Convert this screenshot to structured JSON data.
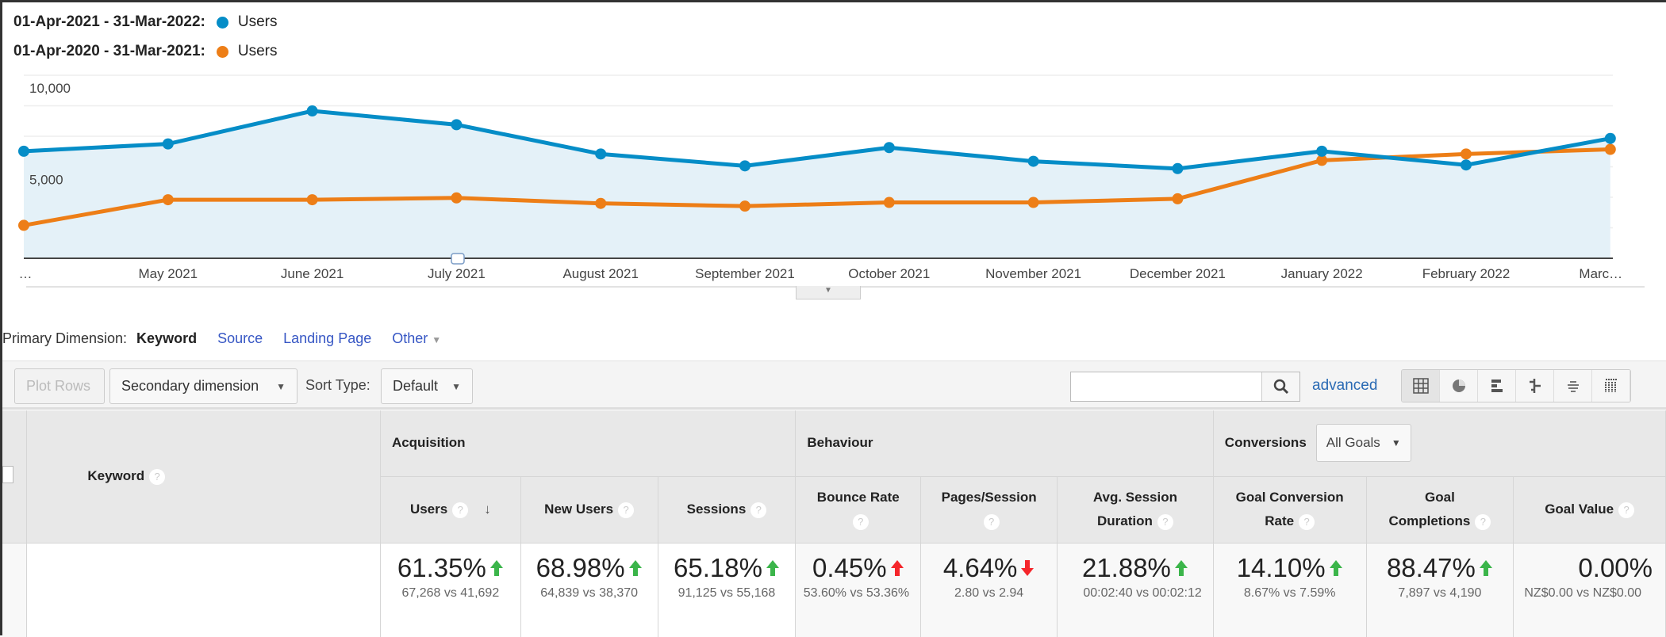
{
  "legend": [
    {
      "label": "01-Apr-2021 - 31-Mar-2022:",
      "series": "Users",
      "color": "#058dc7"
    },
    {
      "label": "01-Apr-2020 - 31-Mar-2021:",
      "series": "Users",
      "color": "#ed7e17"
    }
  ],
  "chart_data": {
    "type": "line",
    "x": [
      "…",
      "May 2021",
      "June 2021",
      "July 2021",
      "August 2021",
      "September 2021",
      "October 2021",
      "November 2021",
      "December 2021",
      "January 2022",
      "February 2022",
      "Marc…"
    ],
    "yticks": [
      "10,000",
      "5,000"
    ],
    "ylim": [
      0,
      10000
    ],
    "grid": true,
    "series": [
      {
        "name": "01-Apr-2021 - 31-Mar-2022: Users",
        "color": "#058dc7",
        "values": [
          5850,
          6250,
          8050,
          7300,
          5700,
          5050,
          6050,
          5300,
          4900,
          5850,
          5100,
          6550
        ]
      },
      {
        "name": "01-Apr-2020 - 31-Mar-2021: Users",
        "color": "#ed7e17",
        "values": [
          1800,
          3200,
          3200,
          3300,
          3000,
          2850,
          3050,
          3050,
          3250,
          5350,
          5700,
          5950
        ]
      }
    ]
  },
  "primary": {
    "label": "Primary Dimension:",
    "current": "Keyword",
    "links": [
      "Source",
      "Landing Page",
      "Other"
    ]
  },
  "toolbar": {
    "plot_rows": "Plot Rows",
    "secondary": "Secondary dimension",
    "sort_label": "Sort Type:",
    "sort_value": "Default",
    "search_value": "",
    "advanced": "advanced"
  },
  "table": {
    "keyword": "Keyword",
    "groups": {
      "acq": "Acquisition",
      "beh": "Behaviour",
      "conv": "Conversions",
      "goals": "All Goals"
    },
    "cols": [
      "Users",
      "New Users",
      "Sessions",
      "Bounce Rate",
      "Pages/Session",
      "Avg. Session Duration",
      "Goal Conversion Rate",
      "Goal Completions",
      "Goal Value"
    ],
    "row": [
      {
        "pct": "61.35%",
        "dir": "up",
        "good": true,
        "cmp": "67,268 vs 41,692"
      },
      {
        "pct": "68.98%",
        "dir": "up",
        "good": true,
        "cmp": "64,839 vs 38,370"
      },
      {
        "pct": "65.18%",
        "dir": "up",
        "good": true,
        "cmp": "91,125 vs 55,168"
      },
      {
        "pct": "0.45%",
        "dir": "up",
        "good": false,
        "cmp": "53.60% vs 53.36%"
      },
      {
        "pct": "4.64%",
        "dir": "down",
        "good": false,
        "cmp": "2.80 vs 2.94"
      },
      {
        "pct": "21.88%",
        "dir": "up",
        "good": true,
        "cmp": "00:02:40 vs 00:02:12"
      },
      {
        "pct": "14.10%",
        "dir": "up",
        "good": true,
        "cmp": "8.67% vs 7.59%"
      },
      {
        "pct": "88.47%",
        "dir": "up",
        "good": true,
        "cmp": "7,897 vs 4,190"
      },
      {
        "pct": "0.00%",
        "dir": "none",
        "good": true,
        "cmp": "NZ$0.00 vs NZ$0.00"
      }
    ]
  }
}
